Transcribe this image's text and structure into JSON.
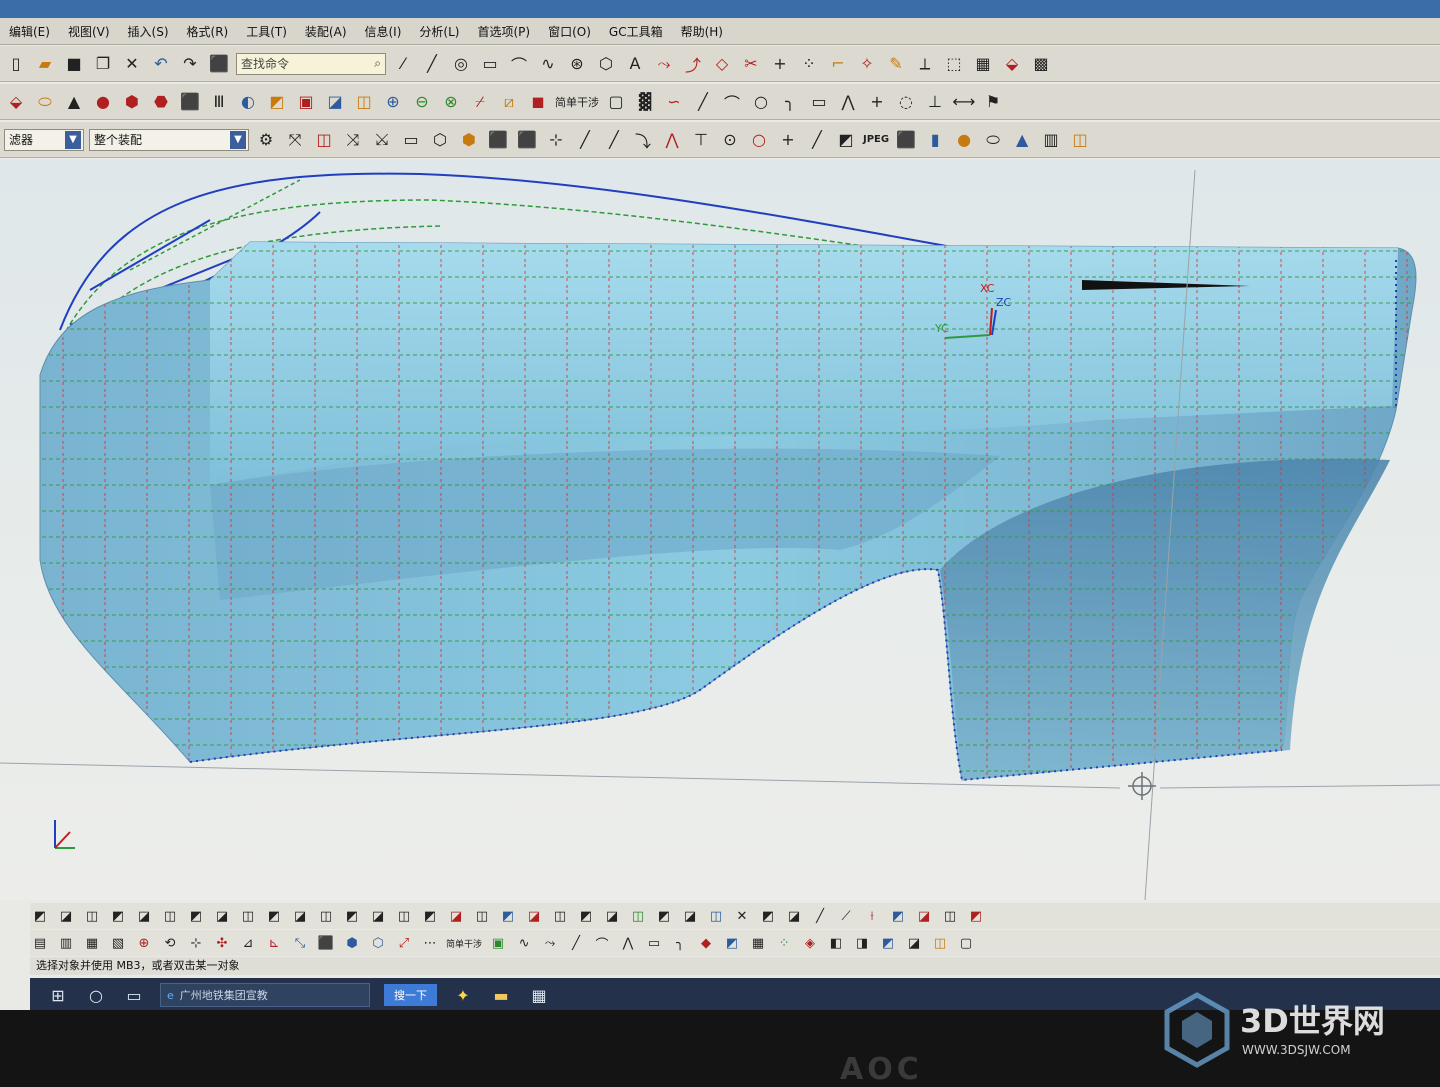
{
  "menu": {
    "items": [
      "编辑(E)",
      "视图(V)",
      "插入(S)",
      "格式(R)",
      "工具(T)",
      "装配(A)",
      "信息(I)",
      "分析(L)",
      "首选项(P)",
      "窗口(O)",
      "GC工具箱",
      "帮助(H)"
    ]
  },
  "toolbar": {
    "search_placeholder": "查找命令",
    "simple_interference": "简单干涉",
    "filter_label": "滤器",
    "assembly_scope": "整个装配",
    "jpeg_label": "JPEG"
  },
  "viewport": {
    "wcs_labels": {
      "xc": "XC",
      "yc": "YC",
      "zc": "ZC"
    }
  },
  "bottom_toolbar": {
    "simple_interference": "简单干涉"
  },
  "status": {
    "prompt": "选择对象并使用 MB3，或者双击某一对象"
  },
  "taskbar": {
    "search_text": "广州地铁集团宣教",
    "button_label": "搜一下"
  },
  "bezel": {
    "brand": "AOC"
  },
  "watermark": {
    "title": "3D世界网",
    "url": "WWW.3DSJW.COM"
  },
  "colors": {
    "surface": "#8ecbe2",
    "surface_shadow": "#5a93b8",
    "grid_green": "#2f9a3a",
    "grid_red": "#d23a3a",
    "grid_blue": "#1f3fbf"
  }
}
